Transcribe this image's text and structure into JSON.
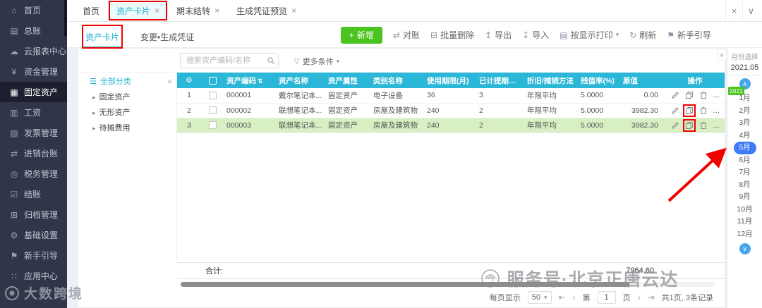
{
  "tabbar": {
    "tabs": [
      {
        "label": "首页",
        "closable": false,
        "active": false,
        "annotated": false
      },
      {
        "label": "资产卡片",
        "closable": true,
        "active": true,
        "annotated": true
      },
      {
        "label": "期末结转",
        "closable": true,
        "active": false,
        "annotated": false
      },
      {
        "label": "生成凭证预览",
        "closable": true,
        "active": false,
        "annotated": false
      }
    ],
    "close_all": "×",
    "tab_list_caret": "∨"
  },
  "sidebar": {
    "items": [
      {
        "label": "首页",
        "icon": "home-icon",
        "active": false
      },
      {
        "label": "总账",
        "icon": "general-ledger-icon",
        "active": false
      },
      {
        "label": "云报表中心",
        "icon": "cloud-report-icon",
        "active": false
      },
      {
        "label": "资金管理",
        "icon": "fund-management-icon",
        "active": false
      },
      {
        "label": "固定资产",
        "icon": "fixed-assets-icon",
        "active": true
      },
      {
        "label": "工资",
        "icon": "salary-icon",
        "active": false
      },
      {
        "label": "发票管理",
        "icon": "invoice-icon",
        "active": false
      },
      {
        "label": "进销台账",
        "icon": "purchase-sales-ledger-icon",
        "active": false
      },
      {
        "label": "税务管理",
        "icon": "tax-icon",
        "active": false
      },
      {
        "label": "结账",
        "icon": "closing-icon",
        "active": false
      },
      {
        "label": "归档管理",
        "icon": "archive-icon",
        "active": false
      },
      {
        "label": "基础设置",
        "icon": "basic-settings-icon",
        "active": false
      },
      {
        "label": "新手引导",
        "icon": "guide-icon",
        "active": false
      },
      {
        "label": "应用中心",
        "icon": "app-center-icon",
        "active": false
      }
    ]
  },
  "subtabs": {
    "items": [
      {
        "label": "资产卡片",
        "active": true,
        "annotated": true
      },
      {
        "label": "变更•生成凭证",
        "active": false,
        "annotated": false
      }
    ]
  },
  "toolbar": {
    "new_button": "新增",
    "buttons": [
      {
        "label": "对账",
        "icon": "reconcile-icon",
        "caret": false
      },
      {
        "label": "批量删除",
        "icon": "batch-delete-icon",
        "caret": false
      },
      {
        "label": "导出",
        "icon": "export-icon",
        "caret": false
      },
      {
        "label": "导入",
        "icon": "import-icon",
        "caret": false
      },
      {
        "label": "按显示打印",
        "icon": "print-icon",
        "caret": true
      },
      {
        "label": "刷新",
        "icon": "refresh-icon",
        "caret": false
      },
      {
        "label": "新手引导",
        "icon": "newbie-guide-icon",
        "caret": false
      }
    ]
  },
  "filters": {
    "search_placeholder": "搜索资产编码/名称",
    "more_label": "更多条件"
  },
  "category_panel": {
    "title": "全部分类",
    "collapse": "«",
    "items": [
      "固定资产",
      "无形资产",
      "待摊费用"
    ]
  },
  "table": {
    "columns": [
      "资产编码",
      "资产名称",
      "资产属性",
      "类别名称",
      "使用期限(月)",
      "已计提期限(月)",
      "折旧/摊销方法",
      "残值率(%)",
      "原值",
      "操作"
    ],
    "rows": [
      {
        "num": "1",
        "code": "000001",
        "name": "戴尔笔记本...",
        "attr": "固定资产",
        "category": "电子设备",
        "term": "36",
        "accrued": "3",
        "method": "年限平均",
        "residual": "5.0000",
        "value": "0.00",
        "selected": false,
        "annotated": false
      },
      {
        "num": "2",
        "code": "000002",
        "name": "联想笔记本...",
        "attr": "固定资产",
        "category": "房屋及建筑物",
        "term": "240",
        "accrued": "2",
        "method": "年限平均",
        "residual": "5.0000",
        "value": "3982.30",
        "selected": false,
        "annotated": true
      },
      {
        "num": "3",
        "code": "000003",
        "name": "联想笔记本...",
        "attr": "固定资产",
        "category": "房屋及建筑物",
        "term": "240",
        "accrued": "2",
        "method": "年限平均",
        "residual": "5.0000",
        "value": "3982.30",
        "selected": true,
        "annotated": true
      }
    ]
  },
  "summary": {
    "label": "合计:",
    "total": "7964.60"
  },
  "pagination": {
    "per_page_label": "每页显示",
    "per_page": "50",
    "page_label_prefix": "第",
    "page_value": "1",
    "page_label_suffix": "页",
    "summary": "共1页, 3条记录"
  },
  "month_panel": {
    "collapse": "»",
    "title": "月份选择",
    "period": "2021.05",
    "year_badge": "2021",
    "months": [
      "1月",
      "2月",
      "3月",
      "4月",
      "5月",
      "6月",
      "7月",
      "8月",
      "9月",
      "10月",
      "11月",
      "12月"
    ],
    "selected": "5月"
  },
  "watermarks": {
    "bottom_left": "大数跨境",
    "bottom_right": "服务号·北京正唐云达"
  },
  "colors": {
    "accent": "#1fb5d3",
    "table_header": "#2bb7d8",
    "primary_green": "#4cc41f",
    "selected_row": "#d8efc4",
    "month_selected": "#3d7bf7",
    "annotation_red": "#f20000",
    "sidebar_bg": "#30354a"
  }
}
